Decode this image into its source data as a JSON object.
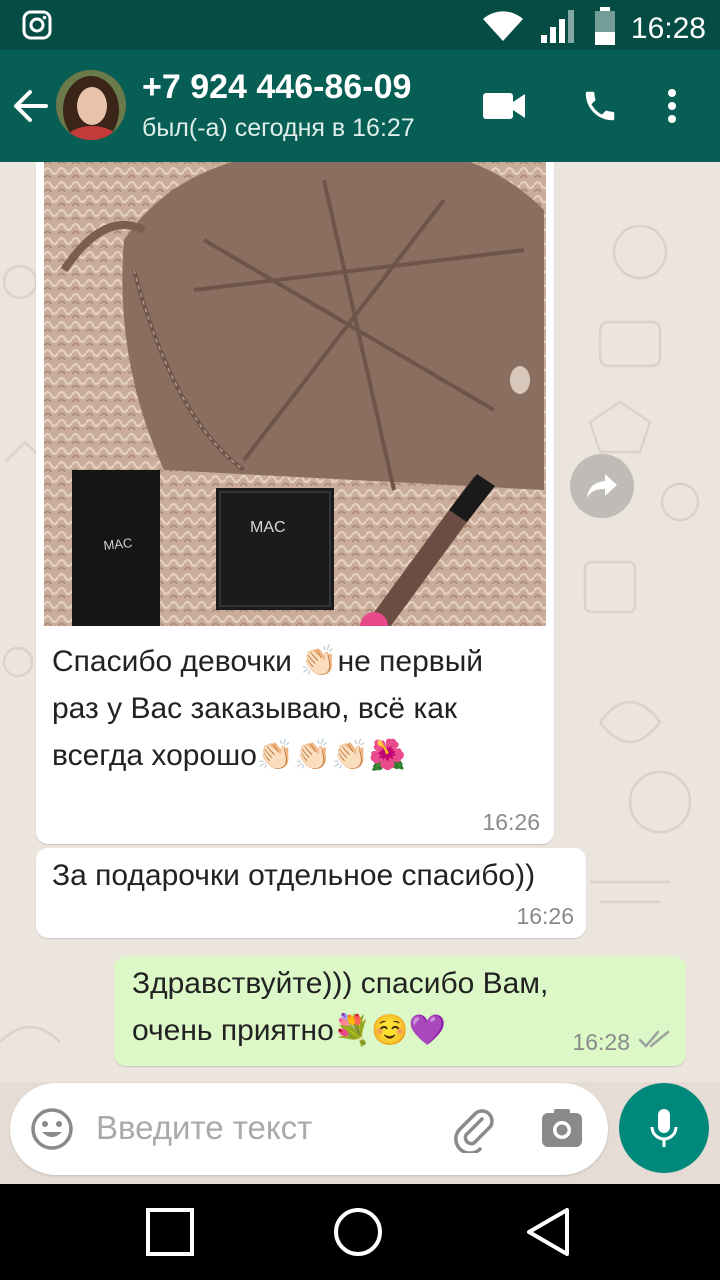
{
  "status_bar": {
    "time": "16:28",
    "icons": [
      "instagram-icon",
      "wifi-icon",
      "signal-icon",
      "battery-icon"
    ]
  },
  "header": {
    "contact_name": "+7 924 446-86-09",
    "last_seen": "был(-а) сегодня в 16:27",
    "icons": [
      "back-arrow-icon",
      "video-call-icon",
      "phone-icon",
      "more-vert-icon"
    ]
  },
  "messages": [
    {
      "type": "incoming",
      "has_photo": true,
      "text_lines": [
        "Спасибо  девочки 👏🏻не первый",
        "раз у Вас заказываю,  всё как",
        "всегда хорошо👏🏻👏🏻👏🏻🌺"
      ],
      "time": "16:26"
    },
    {
      "type": "incoming",
      "text_lines": [
        "За подарочки отдельное спасибо))"
      ],
      "time": "16:26"
    },
    {
      "type": "outgoing",
      "text_lines": [
        "Здравствуйте))) спасибо Вам,",
        "очень приятно💐☺️💜"
      ],
      "time": "16:28",
      "status": "read"
    }
  ],
  "input": {
    "placeholder": "Введите текст",
    "icons": [
      "emoji-icon",
      "attach-icon",
      "camera-icon",
      "mic-icon"
    ]
  },
  "colors": {
    "status_bar": "#054d44",
    "header": "#075e54",
    "outgoing_bubble": "#dcf8c6",
    "incoming_bubble": "#ffffff",
    "mic_button": "#00897b",
    "read_ticks": "#9ea3a0"
  }
}
